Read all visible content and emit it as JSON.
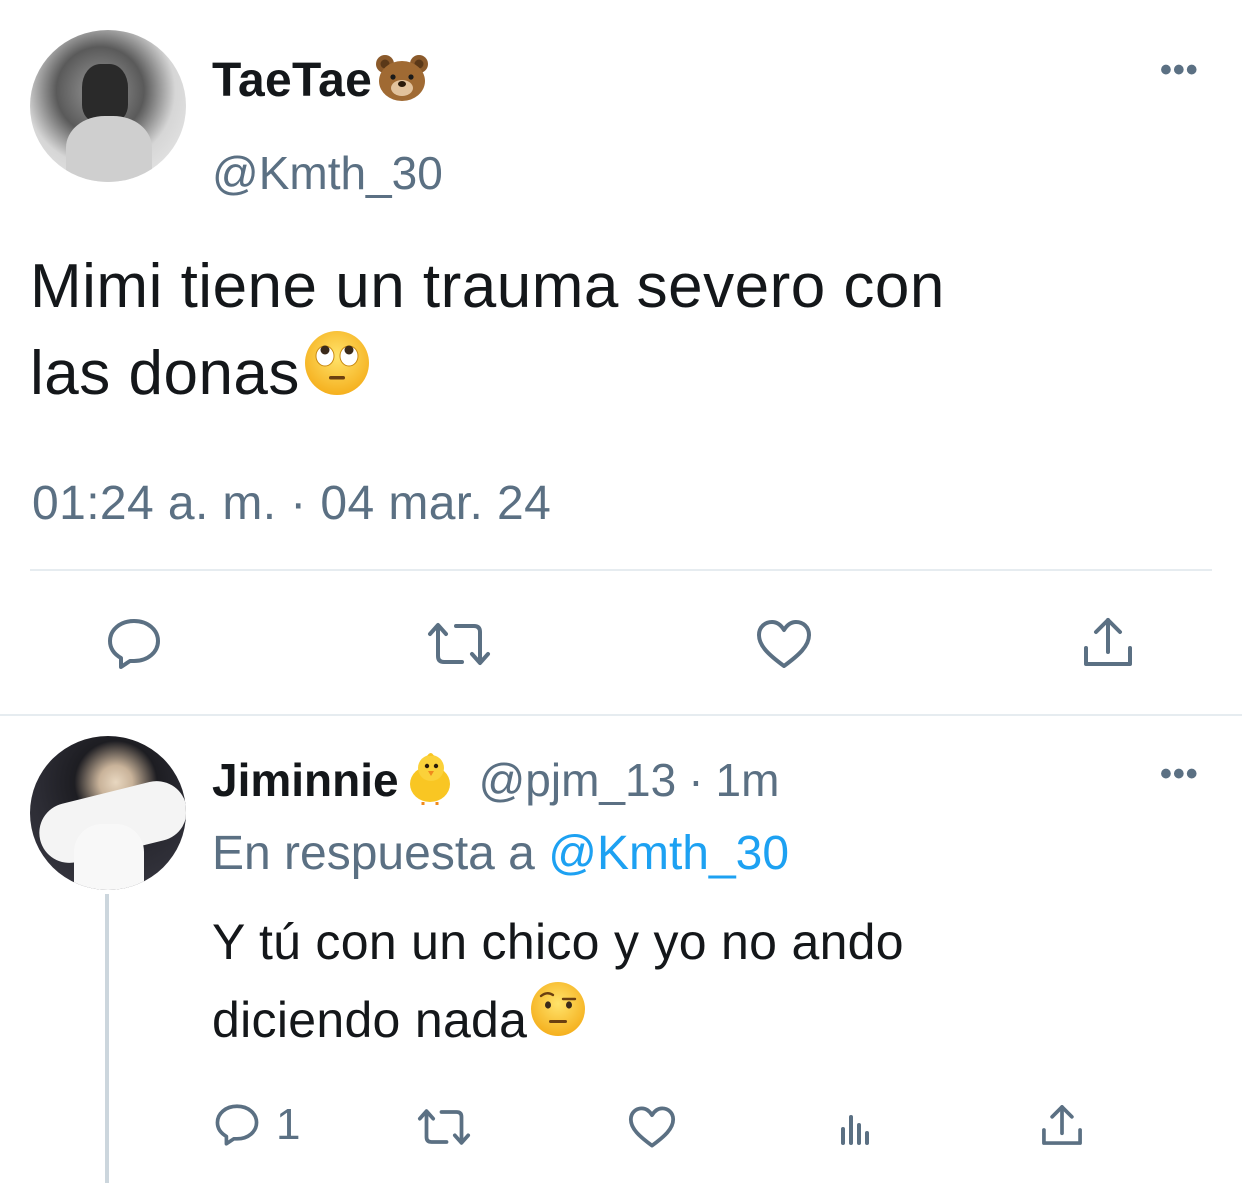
{
  "main_tweet": {
    "display_name": "TaeTae",
    "name_emoji": "bear-face-emoji",
    "handle": "@Kmth_30",
    "text": "Mimi tiene un trauma severo con las donas",
    "text_line1": "Mimi tiene un trauma severo con",
    "text_line2": "las donas",
    "text_emoji": "face-with-rolling-eyes-emoji",
    "timestamp": "01:24 a. m. · 04 mar. 24",
    "more_icon": "more-dots-icon",
    "actions": [
      "reply-icon",
      "retweet-icon",
      "like-icon",
      "share-icon"
    ]
  },
  "reply_tweet": {
    "display_name": "Jiminnie",
    "name_emoji": "baby-chick-emoji",
    "handle": "@pjm_13",
    "separator": "·",
    "time_ago": "1m",
    "reply_prefix": "En respuesta a",
    "reply_mention": "@Kmth_30",
    "text_line1": "Y tú con un chico y yo no ando",
    "text_line2": "diciendo nada",
    "text_emoji": "face-with-raised-eyebrow-emoji",
    "reply_count": "1",
    "more_icon": "more-dots-icon",
    "actions": [
      "reply-icon",
      "retweet-icon",
      "like-icon",
      "analytics-icon",
      "share-icon"
    ]
  },
  "colors": {
    "text_primary": "#14171a",
    "text_secondary": "#5b7083",
    "link": "#1da1f2",
    "divider": "#e6ecf0",
    "thread_line": "#ccd6dd"
  }
}
